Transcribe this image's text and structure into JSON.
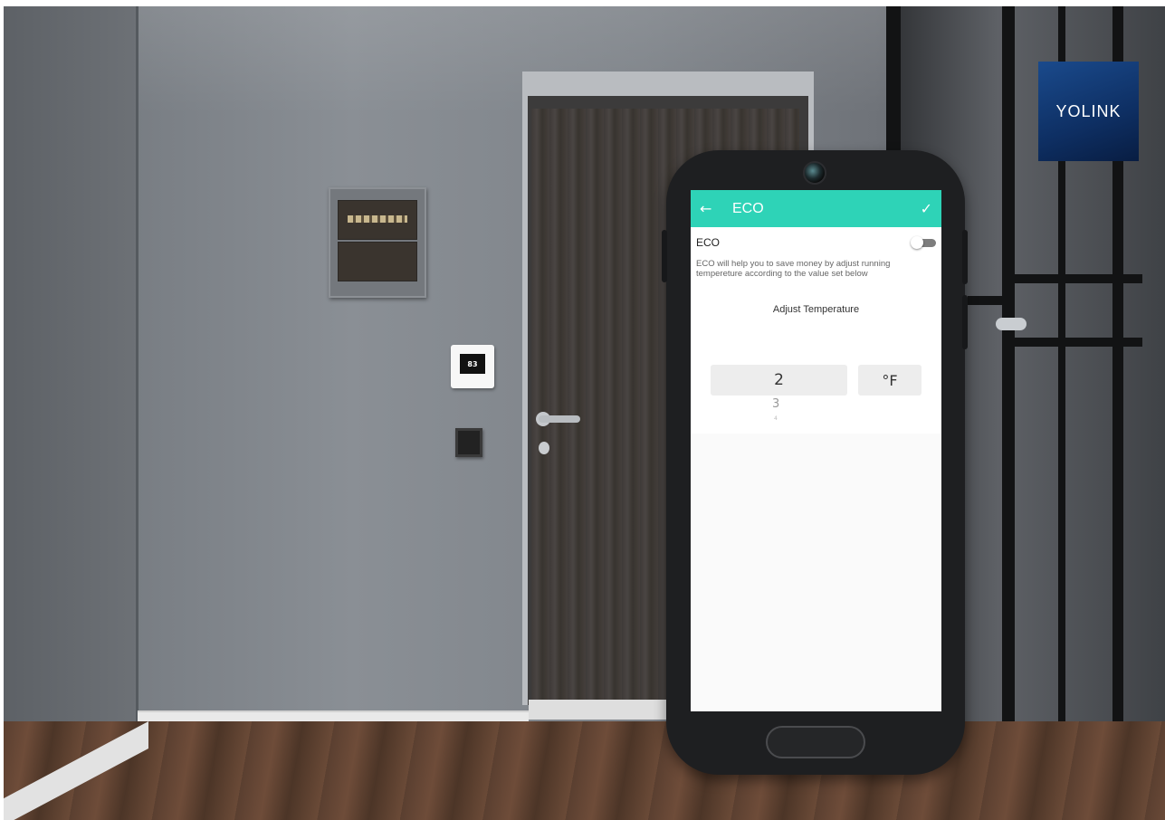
{
  "brand": {
    "logo_text": "YOLINK",
    "color": "#123a78"
  },
  "thermostat": {
    "display_temp": "83"
  },
  "app": {
    "header": {
      "back_icon": "arrow-left-icon",
      "title": "ECO",
      "confirm_icon": "check-icon",
      "color": "#2ed3b7"
    },
    "eco_toggle": {
      "label": "ECO",
      "state": "off"
    },
    "description": "ECO will help you to save money by adjust running tempereture according to the value set below",
    "adjust": {
      "title": "Adjust Temperature",
      "value": "2",
      "unit": "°F",
      "next_value": "3",
      "next_value_2": "4"
    }
  }
}
